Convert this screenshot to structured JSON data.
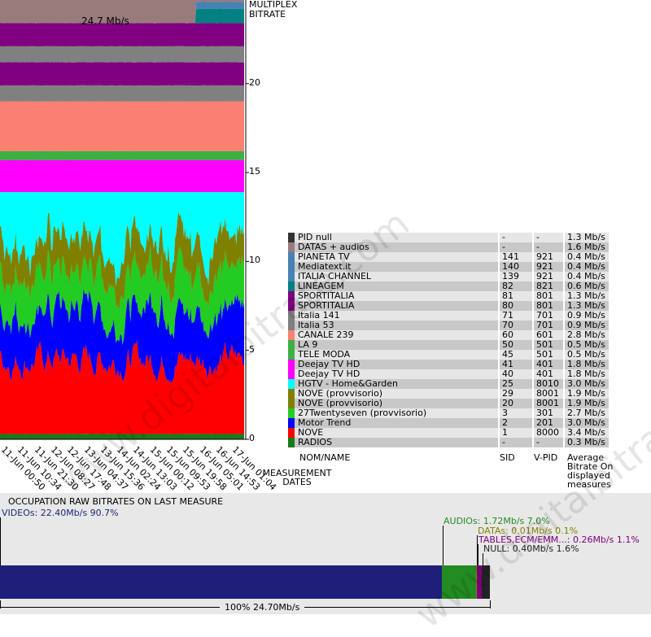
{
  "chart_data": {
    "type": "area",
    "title": "24.7 Mb/s",
    "ylabel": "MULTIPLEX BITRATE",
    "xlabel": "MEASUREMENT DATES",
    "ylim": [
      0,
      24.7
    ],
    "yticks": [
      0,
      5,
      10,
      15,
      20
    ],
    "x": [
      "11-Jun 00:50",
      "11-Jun 10:34",
      "11-Jun 21:30",
      "12-Jun 08:27",
      "12-Jun 17:48",
      "13-Jun 04:37",
      "13-Jun 15:36",
      "14-Jun 02:24",
      "14-Jun 13:03",
      "15-Jun 00:12",
      "15-Jun 09:53",
      "15-Jun 19:58",
      "16-Jun 05:01",
      "16-Jun 14:53",
      "17-Jun 01:04"
    ],
    "series_stack_order": [
      "NOVE",
      "Motor Trend",
      "NOVE (provvisorio) 20",
      "NOVE (provvisorio) 29",
      "HGTV - Home&Garden",
      "RADIOS",
      "TELE MODA",
      "LA 9",
      "CANALE 239",
      "Italia 53",
      "Italia 141",
      "SPORTITALIA 80",
      "SPORTITALIA 81",
      "LINEAGEM",
      "ITALIA CHANNEL",
      "Mediatext.it",
      "PIANETA TV",
      "DATAS + audios",
      "PID null"
    ]
  },
  "legend": {
    "rows": [
      {
        "name": "PID null",
        "sid": "-",
        "vpid": "-",
        "bitrate": "1.3 Mb/s",
        "color": "#333333"
      },
      {
        "name": "DATAS + audios",
        "sid": "-",
        "vpid": "-",
        "bitrate": "1.6 Mb/s",
        "color": "#9a7b7b"
      },
      {
        "name": "PIANETA TV",
        "sid": "141",
        "vpid": "921",
        "bitrate": "0.4 Mb/s",
        "color": "#4682b4"
      },
      {
        "name": "Mediatext.it",
        "sid": "140",
        "vpid": "921",
        "bitrate": "0.4 Mb/s",
        "color": "#4682b4"
      },
      {
        "name": "ITALIA CHANNEL",
        "sid": "139",
        "vpid": "921",
        "bitrate": "0.4 Mb/s",
        "color": "#4682b4"
      },
      {
        "name": "LINEAGEM",
        "sid": "82",
        "vpid": "821",
        "bitrate": "0.6 Mb/s",
        "color": "#008080"
      },
      {
        "name": "SPORTITALIA",
        "sid": "81",
        "vpid": "801",
        "bitrate": "1.3 Mb/s",
        "color": "#800080"
      },
      {
        "name": "SPORTITALIA",
        "sid": "80",
        "vpid": "801",
        "bitrate": "1.3 Mb/s",
        "color": "#800080"
      },
      {
        "name": "Italia 141",
        "sid": "71",
        "vpid": "701",
        "bitrate": "0.9 Mb/s",
        "color": "#808080"
      },
      {
        "name": "Italia 53",
        "sid": "70",
        "vpid": "701",
        "bitrate": "0.9 Mb/s",
        "color": "#808080"
      },
      {
        "name": "CANALE 239",
        "sid": "60",
        "vpid": "601",
        "bitrate": "2.8 Mb/s",
        "color": "#fa8072"
      },
      {
        "name": "LA 9",
        "sid": "50",
        "vpid": "501",
        "bitrate": "0.5 Mb/s",
        "color": "#3cb043"
      },
      {
        "name": "TELE MODA",
        "sid": "45",
        "vpid": "501",
        "bitrate": "0.5 Mb/s",
        "color": "#3cb043"
      },
      {
        "name": "Deejay TV HD",
        "sid": "41",
        "vpid": "401",
        "bitrate": "1.8 Mb/s",
        "color": "#ff00ff"
      },
      {
        "name": "Deejay TV HD",
        "sid": "40",
        "vpid": "401",
        "bitrate": "1.8 Mb/s",
        "color": "#ff00ff"
      },
      {
        "name": "HGTV - Home&Garden",
        "sid": "25",
        "vpid": "8010",
        "bitrate": "3.0 Mb/s",
        "color": "#00ffff"
      },
      {
        "name": "NOVE (provvisorio)",
        "sid": "29",
        "vpid": "8001",
        "bitrate": "1.9 Mb/s",
        "color": "#808000"
      },
      {
        "name": "NOVE (provvisorio)",
        "sid": "20",
        "vpid": "8001",
        "bitrate": "1.9 Mb/s",
        "color": "#808000"
      },
      {
        "name": "27Twentyseven (provvisorio)",
        "sid": "3",
        "vpid": "301",
        "bitrate": "2.7 Mb/s",
        "color": "#22cc22"
      },
      {
        "name": "Motor Trend",
        "sid": "2",
        "vpid": "201",
        "bitrate": "3.0 Mb/s",
        "color": "#0000ff"
      },
      {
        "name": "NOVE",
        "sid": "1",
        "vpid": "8000",
        "bitrate": "3.4 Mb/s",
        "color": "#ff0000"
      },
      {
        "name": "RADIOS",
        "sid": "-",
        "vpid": "-",
        "bitrate": "0.3 Mb/s",
        "color": "#1a7a1a"
      }
    ],
    "header": {
      "name": "NOM/NAME",
      "sid": "SID",
      "vpid": "V-PID",
      "bitrate": "Average Bitrate On displayed measures"
    }
  },
  "occupation": {
    "title": "OCCUPATION RAW BITRATES ON LAST MEASURE",
    "videos": {
      "label": "VIDEOs: 22.40Mb/s  90.7%",
      "value": 22.4,
      "percent": 90.7,
      "color": "#1f1f7a"
    },
    "audios": {
      "label": "AUDIOs: 1.72Mb/s  7.0%",
      "value": 1.72,
      "percent": 7.0,
      "color": "#228b22"
    },
    "datas": {
      "label": "DATAs: 0.01Mb/s  0.1%",
      "value": 0.01,
      "percent": 0.1,
      "color": "#808000"
    },
    "tables": {
      "label": "TABLES,ECM/EMM...: 0.26Mb/s  1.1%",
      "value": 0.26,
      "percent": 1.1,
      "color": "#800080"
    },
    "null": {
      "label": "NULL: 0.40Mb/s  1.6%",
      "value": 0.4,
      "percent": 1.6,
      "color": "#222222"
    },
    "total": "100%  24.70Mb/s"
  },
  "watermark": "www.digitalbitrate.com"
}
